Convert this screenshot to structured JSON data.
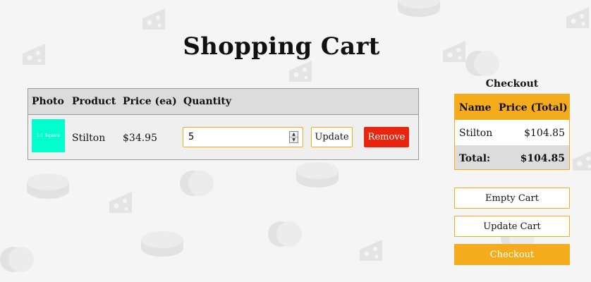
{
  "page": {
    "title": "Shopping Cart"
  },
  "cart": {
    "headers": {
      "photo": "Photo",
      "product": "Product",
      "price": "Price (ea)",
      "quantity": "Quantity"
    },
    "items": [
      {
        "thumb_text": "1:1 Square",
        "thumb_color": "#00ffcc",
        "product": "Stilton",
        "price": "$34.95",
        "quantity": "5",
        "update_label": "Update",
        "remove_label": "Remove"
      }
    ]
  },
  "checkout": {
    "title": "Checkout",
    "headers": {
      "name": "Name",
      "price_total": "Price (Total)"
    },
    "rows": [
      {
        "name": "Stilton",
        "total": "$104.85"
      }
    ],
    "total_label": "Total:",
    "total_value": "$104.85",
    "buttons": {
      "empty_cart": "Empty Cart",
      "update_cart": "Update Cart",
      "checkout": "Checkout"
    }
  },
  "colors": {
    "accent": "#f4ac1c",
    "remove": "#e8260f",
    "background": "#f5f5f5"
  },
  "background_icons": [
    "cheese-wedge-icon",
    "cheese-wheel-icon"
  ]
}
